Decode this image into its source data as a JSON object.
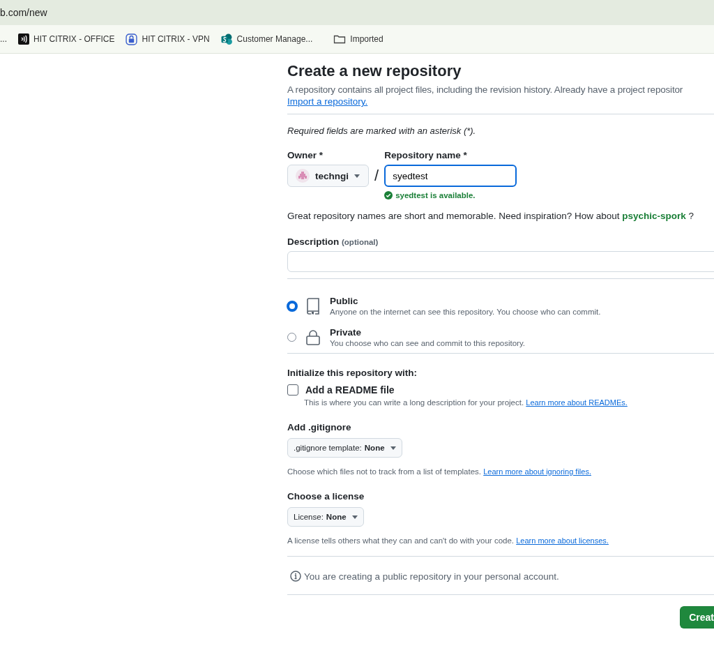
{
  "browser": {
    "url": "b.com/new",
    "bookmarks": [
      {
        "label": "...",
        "kind": "none"
      },
      {
        "label": "HIT CITRIX - OFFICE",
        "kind": "citrix"
      },
      {
        "label": "HIT CITRIX - VPN",
        "kind": "lock"
      },
      {
        "label": "Customer Manage...",
        "kind": "sharepoint"
      },
      {
        "label": "Imported",
        "kind": "folder"
      }
    ]
  },
  "page": {
    "title": "Create a new repository",
    "intro": "A repository contains all project files, including the revision history. Already have a project repositor",
    "import_link": "Import a repository.",
    "required_note": "Required fields are marked with an asterisk (*).",
    "owner": {
      "label": "Owner *",
      "value": "techngi"
    },
    "separator": "/",
    "repo_name": {
      "label": "Repository name *",
      "value": "syedtest",
      "status": "syedtest is available."
    },
    "suggestion": {
      "text": "Great repository names are short and memorable. Need inspiration? How about",
      "name": "psychic-spork",
      "end": "?"
    },
    "description": {
      "label": "Description",
      "hint": "(optional)"
    },
    "visibility": [
      {
        "label": "Public",
        "desc": "Anyone on the internet can see this repository. You choose who can commit.",
        "kind": "book",
        "selected": true
      },
      {
        "label": "Private",
        "desc": "You choose who can see and commit to this repository.",
        "kind": "lock",
        "selected": false
      }
    ],
    "init_heading": "Initialize this repository with:",
    "readme": {
      "label": "Add a README file",
      "checked": false,
      "desc": "This is where you can write a long description for your project.",
      "link": "Learn more about READMEs."
    },
    "gitignore": {
      "heading": "Add .gitignore",
      "button_label": ".gitignore template:",
      "button_value": "None",
      "desc": "Choose which files not to track from a list of templates.",
      "link": "Learn more about ignoring files."
    },
    "license": {
      "heading": "Choose a license",
      "button_label": "License:",
      "button_value": "None",
      "desc": "A license tells others what they can and can't do with your code.",
      "link": "Learn more about licenses."
    },
    "notice": "You are creating a public repository in your personal account.",
    "submit": "Creat"
  }
}
